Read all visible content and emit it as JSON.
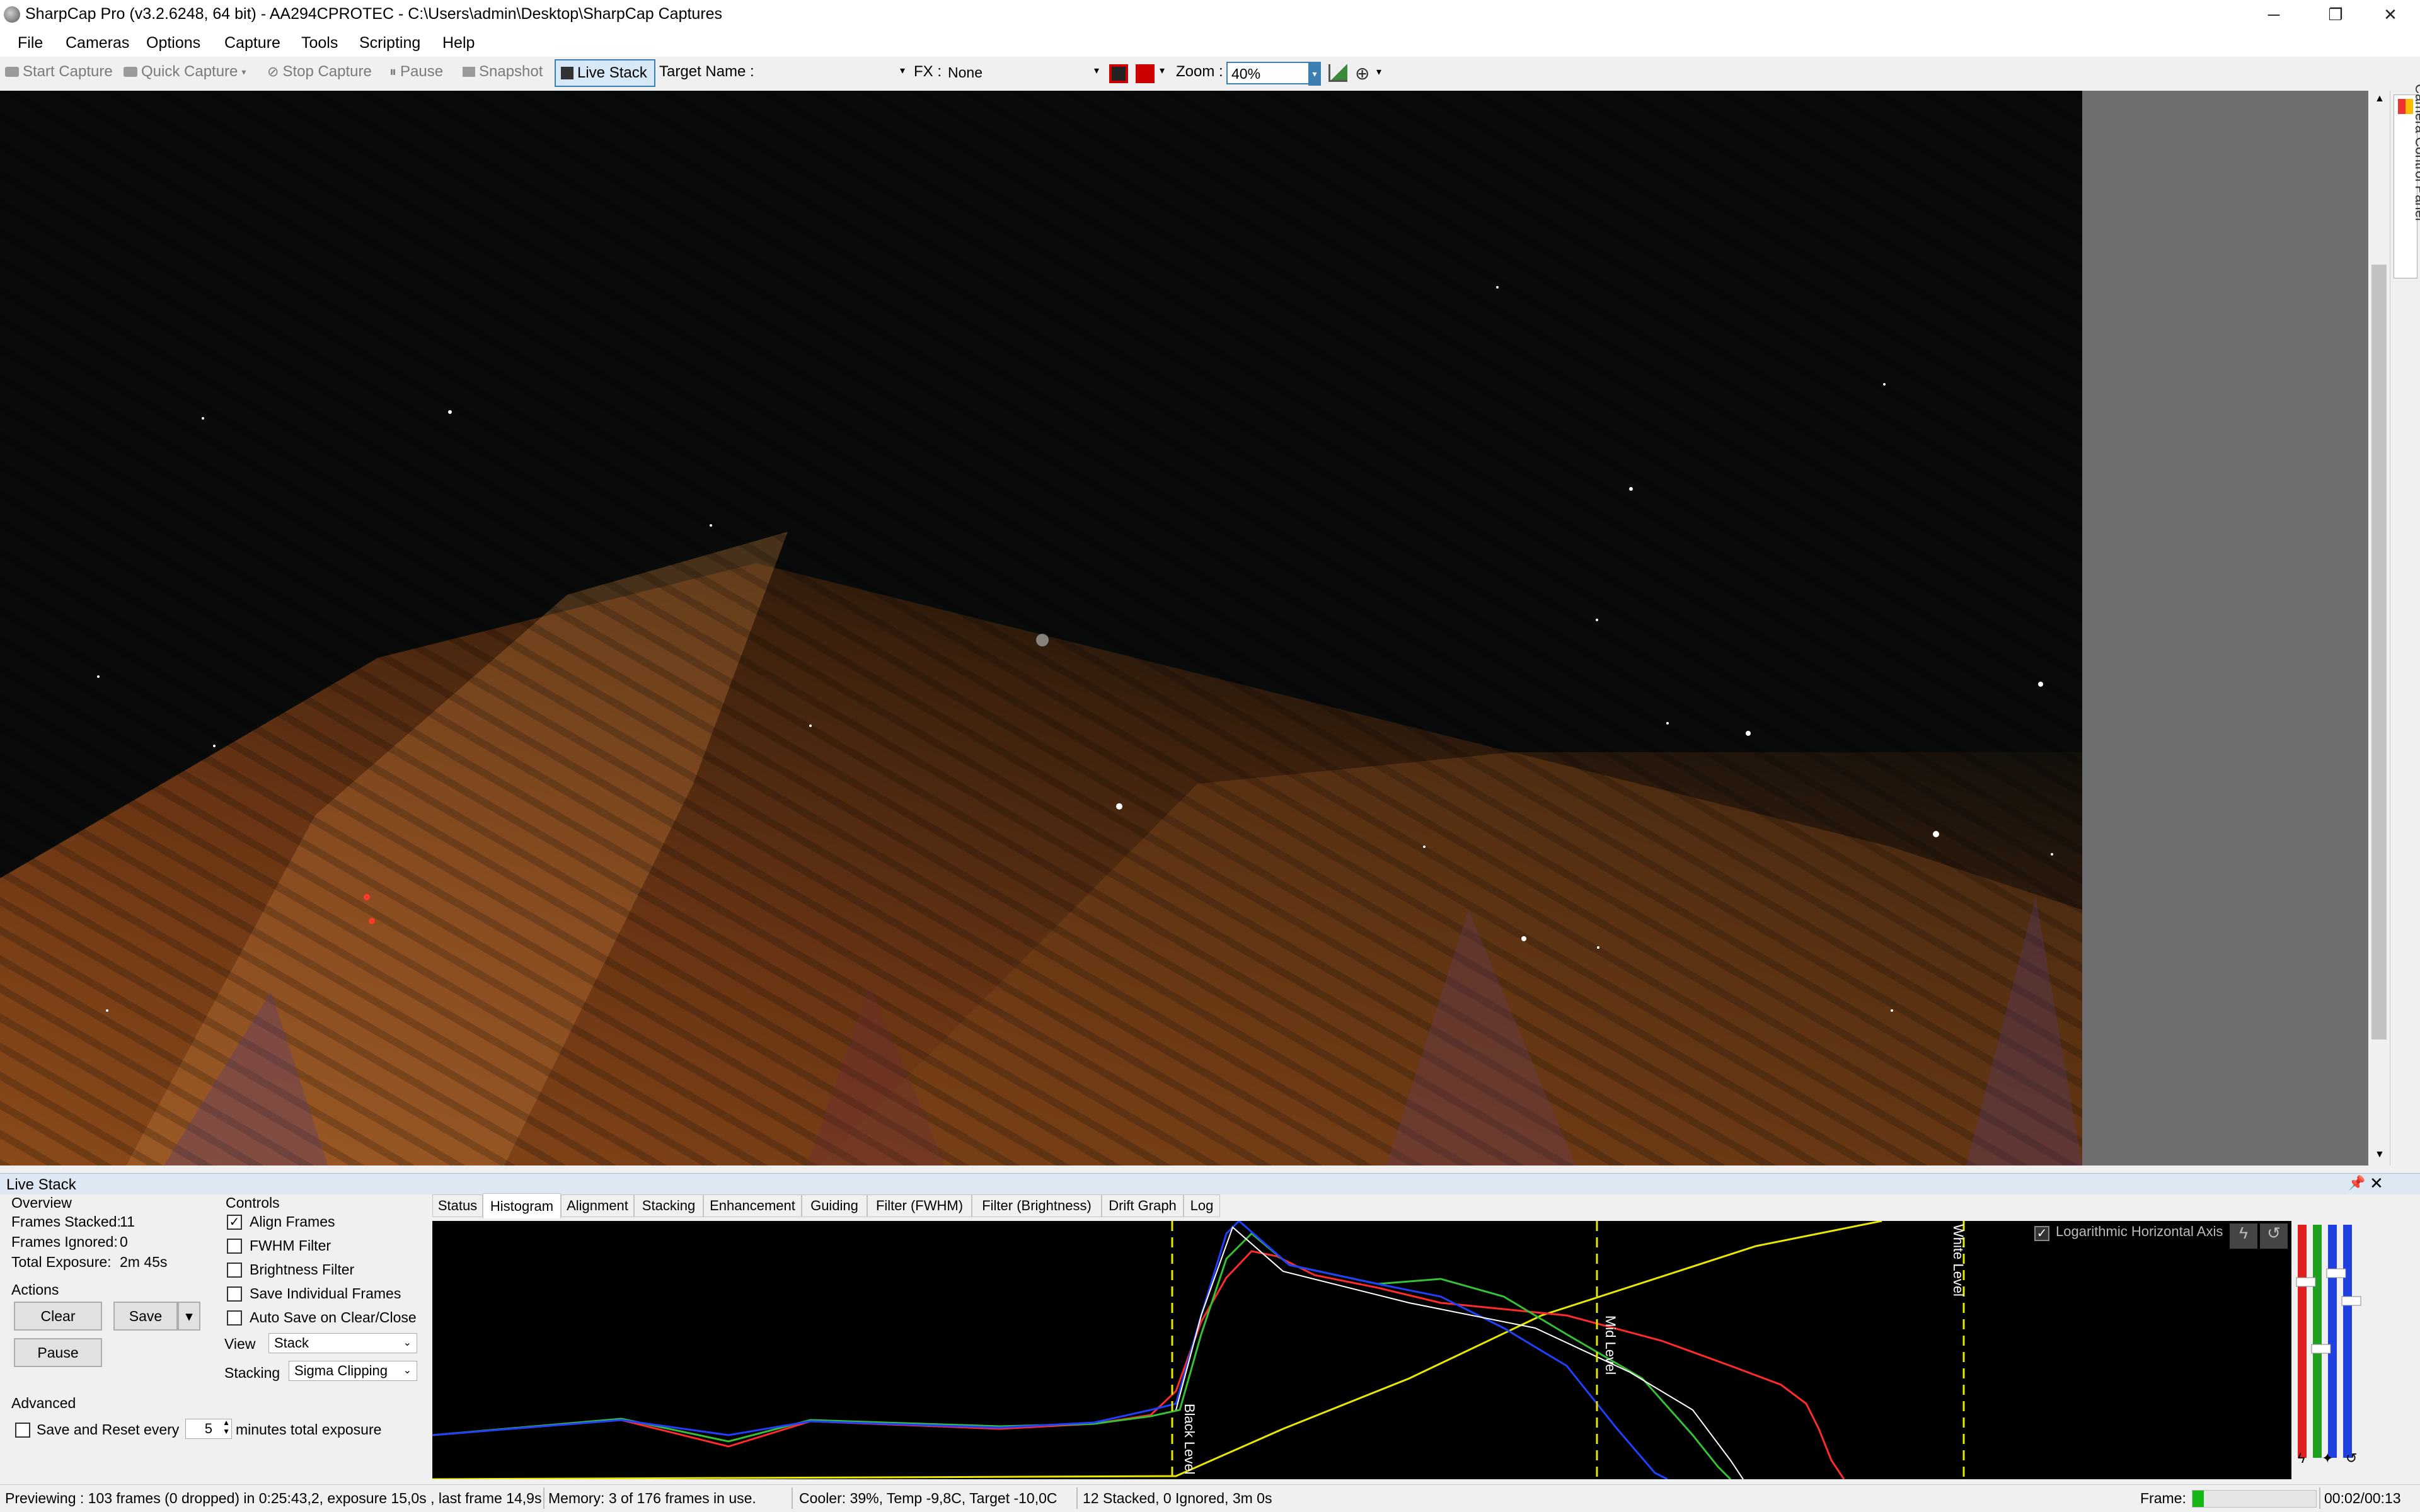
{
  "window": {
    "title": "SharpCap Pro (v3.2.6248, 64 bit) - AA294CPROTEC - C:\\Users\\admin\\Desktop\\SharpCap Captures",
    "minimize": "─",
    "maximize": "❐",
    "close": "✕"
  },
  "menu": [
    "File",
    "Cameras",
    "Options",
    "Capture",
    "Tools",
    "Scripting",
    "Help"
  ],
  "toolbar": {
    "start_capture": "Start Capture",
    "quick_capture": "Quick Capture",
    "stop_capture": "Stop Capture",
    "pause": "Pause",
    "snapshot": "Snapshot",
    "live_stack": "Live Stack",
    "target_name_label": "Target Name :",
    "target_name_value": "",
    "fx_label": "FX :",
    "fx_value": "None",
    "zoom_label": "Zoom :",
    "zoom_value": "40%"
  },
  "side_panel": {
    "label": "Camera Control Panel"
  },
  "live_stack": {
    "title": "Live Stack",
    "overview": {
      "heading": "Overview",
      "frames_stacked_label": "Frames Stacked:",
      "frames_stacked": "11",
      "frames_ignored_label": "Frames Ignored:",
      "frames_ignored": "0",
      "total_exposure_label": "Total Exposure:",
      "total_exposure": "2m 45s"
    },
    "actions": {
      "heading": "Actions",
      "clear": "Clear",
      "save": "Save",
      "pause": "Pause"
    },
    "advanced": {
      "heading": "Advanced",
      "save_reset_label": "Save and Reset every",
      "save_reset_value": "5",
      "save_reset_suffix": "minutes total exposure"
    },
    "controls": {
      "heading": "Controls",
      "align_frames": "Align Frames",
      "fwhm_filter": "FWHM Filter",
      "brightness_filter": "Brightness Filter",
      "save_individual": "Save Individual Frames",
      "auto_save": "Auto Save on Clear/Close",
      "view_label": "View",
      "view_value": "Stack",
      "stacking_label": "Stacking",
      "stacking_value": "Sigma Clipping"
    },
    "tabs": [
      "Status",
      "Histogram",
      "Alignment",
      "Stacking",
      "Enhancement",
      "Guiding",
      "Filter (FWHM)",
      "Filter (Brightness)",
      "Drift Graph",
      "Log"
    ],
    "histogram": {
      "log_axis_label": "Logarithmic Horizontal Axis",
      "black_level": "Black Level",
      "mid_level": "Mid Level",
      "white_level": "White Level",
      "line_color": "#e8e800"
    }
  },
  "status": {
    "previewing": "Previewing : 103 frames (0 dropped) in 0:25:43,2, exposure 15,0s , last frame 14,9s",
    "memory": "Memory: 3 of 176 frames in use.",
    "cooler": "Cooler: 39%, Temp -9,8C, Target -10,0C",
    "stacked": "12 Stacked, 0 Ignored, 3m 0s",
    "frame_label": "Frame:",
    "time": "00:02/00:13"
  }
}
